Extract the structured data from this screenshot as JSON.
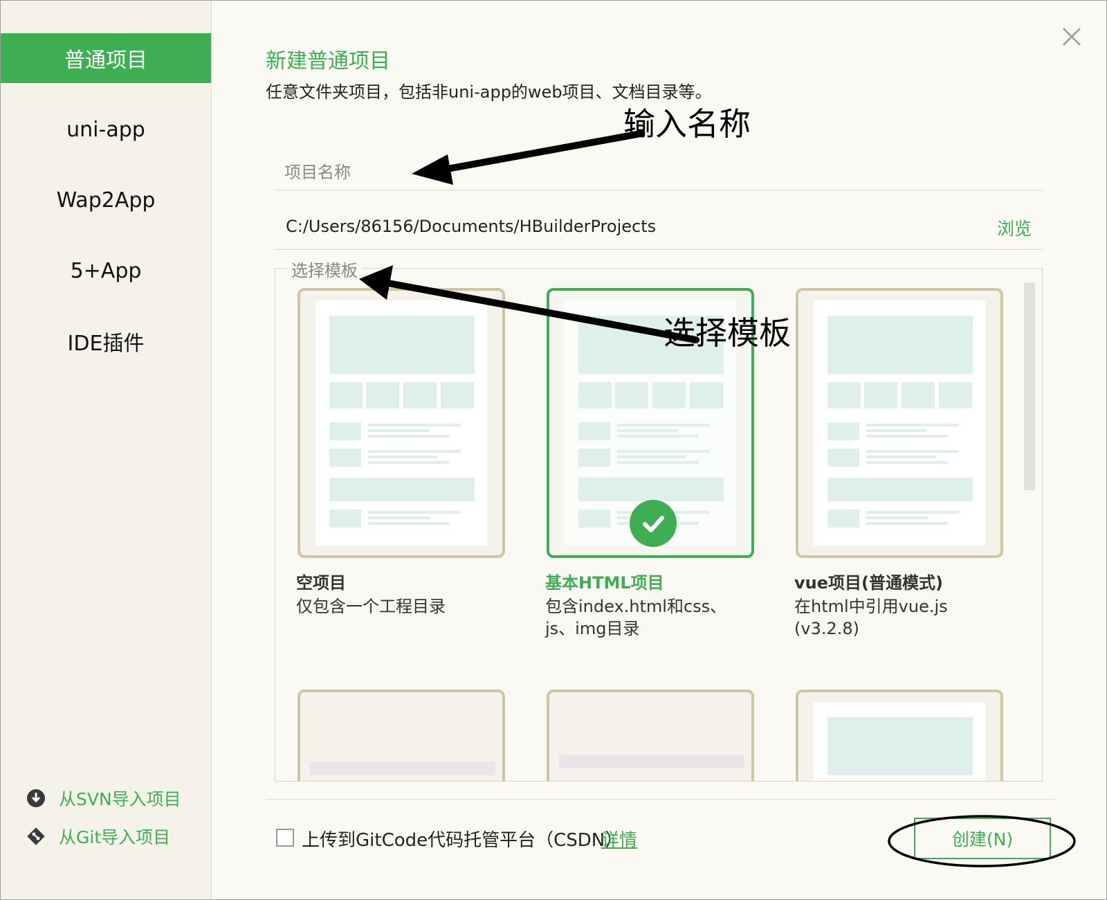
{
  "sidebar": {
    "items": [
      {
        "label": "普通项目",
        "active": true
      },
      {
        "label": "uni-app"
      },
      {
        "label": "Wap2App"
      },
      {
        "label": "5+App"
      },
      {
        "label": "IDE插件"
      }
    ],
    "links": [
      {
        "label": "从SVN导入项目",
        "icon": "svn-download-icon"
      },
      {
        "label": "从Git导入项目",
        "icon": "git-icon"
      }
    ]
  },
  "dialog": {
    "title": "新建普通项目",
    "subtitle": "任意文件夹项目，包括非uni-app的web项目、文档目录等。",
    "close_icon": "close-icon"
  },
  "form": {
    "name_placeholder": "项目名称",
    "path": "C:/Users/86156/Documents/HBuilderProjects",
    "browse_label": "浏览"
  },
  "templates": {
    "legend": "选择模板",
    "items": [
      {
        "title": "空项目",
        "desc": "仅包含一个工程目录",
        "selected": false
      },
      {
        "title": "基本HTML项目",
        "desc": "包含index.html和css、js、img目录",
        "selected": true
      },
      {
        "title": "vue项目(普通模式)",
        "desc": "在html中引用vue.js (v3.2.8)",
        "selected": false
      }
    ]
  },
  "footer": {
    "upload_label": "上传到GitCode代码托管平台（CSDN）",
    "details_label": "详情",
    "create_label": "创建(N)"
  },
  "annotations": {
    "name_hint": "输入名称",
    "template_hint": "选择模板"
  },
  "colors": {
    "accent": "#3fae52",
    "card_border": "#cfc6a4",
    "placeholder_block": "#dff0ea"
  }
}
